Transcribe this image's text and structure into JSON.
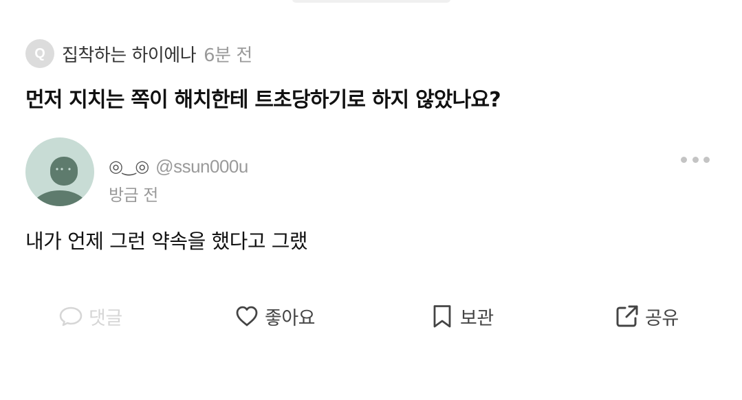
{
  "question": {
    "badge": "Q",
    "author": "집착하는 하이에나",
    "time": "6분 전",
    "text": "먼저 지치는 쪽이 해치한테 트초당하기로 하지 않았나요?"
  },
  "answer": {
    "display_name": "◎‿◎",
    "handle": "@ssun000u",
    "time": "방금 전",
    "text": "내가 언제 그런 약속을 했다고 그랬",
    "more_icon": "more-dots-icon"
  },
  "actions": [
    {
      "label": "댓글",
      "icon": "comment-icon"
    },
    {
      "label": "좋아요",
      "icon": "heart-icon"
    },
    {
      "label": "보관",
      "icon": "bookmark-icon"
    },
    {
      "label": "공유",
      "icon": "share-icon"
    }
  ],
  "colors": {
    "avatar_bg": "#c8dcd5",
    "avatar_figure": "#5e7b6d",
    "muted": "#9a9a9a",
    "disabled": "#d6d6d6"
  }
}
